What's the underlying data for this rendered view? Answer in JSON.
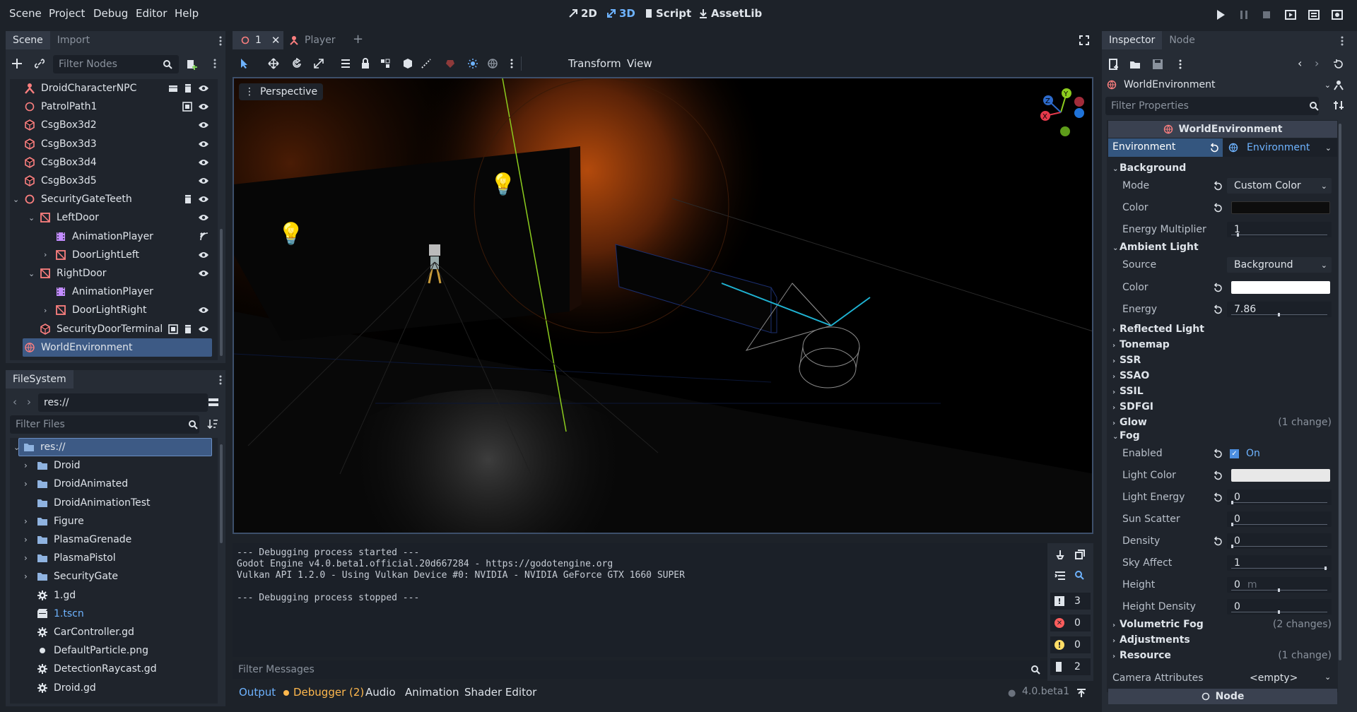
{
  "menu": [
    "Scene",
    "Project",
    "Debug",
    "Editor",
    "Help"
  ],
  "modes": {
    "m2d": "2D",
    "m3d": "3D",
    "script": "Script",
    "assetlib": "AssetLib"
  },
  "scene_dock": {
    "tabs": [
      "Scene",
      "Import"
    ],
    "filter_placeholder": "Filter Nodes",
    "nodes": [
      {
        "label": "DroidCharacterNPC",
        "indent": 0,
        "icon": "character-icon"
      },
      {
        "label": "PatrolPath1",
        "indent": 0,
        "icon": "path-icon"
      },
      {
        "label": "CsgBox3d2",
        "indent": 0,
        "icon": "csg-icon"
      },
      {
        "label": "CsgBox3d3",
        "indent": 0,
        "icon": "csg-icon"
      },
      {
        "label": "CsgBox3d4",
        "indent": 0,
        "icon": "csg-icon"
      },
      {
        "label": "CsgBox3d5",
        "indent": 0,
        "icon": "csg-icon"
      },
      {
        "label": "SecurityGateTeeth",
        "indent": 0,
        "icon": "node3d-icon"
      },
      {
        "label": "LeftDoor",
        "indent": 1,
        "icon": "body-icon"
      },
      {
        "label": "AnimationPlayer",
        "indent": 2,
        "icon": "animation-icon"
      },
      {
        "label": "DoorLightLeft",
        "indent": 2,
        "icon": "body-icon"
      },
      {
        "label": "RightDoor",
        "indent": 1,
        "icon": "body-icon"
      },
      {
        "label": "AnimationPlayer",
        "indent": 2,
        "icon": "animation-icon"
      },
      {
        "label": "DoorLightRight",
        "indent": 2,
        "icon": "body-icon"
      },
      {
        "label": "SecurityDoorTerminal",
        "indent": 1,
        "icon": "csg-icon"
      },
      {
        "label": "WorldEnvironment",
        "indent": 0,
        "icon": "world-icon"
      }
    ]
  },
  "filesystem": {
    "title": "FileSystem",
    "path": "res://",
    "filter_placeholder": "Filter Files",
    "items": [
      {
        "label": "res://",
        "type": "root"
      },
      {
        "label": "Droid",
        "type": "folder"
      },
      {
        "label": "DroidAnimated",
        "type": "folder"
      },
      {
        "label": "DroidAnimationTest",
        "type": "folder"
      },
      {
        "label": "Figure",
        "type": "folder"
      },
      {
        "label": "PlasmaGrenade",
        "type": "folder"
      },
      {
        "label": "PlasmaPistol",
        "type": "folder"
      },
      {
        "label": "SecurityGate",
        "type": "folder"
      },
      {
        "label": "1.gd",
        "type": "script"
      },
      {
        "label": "1.tscn",
        "type": "scene"
      },
      {
        "label": "CarController.gd",
        "type": "script"
      },
      {
        "label": "DefaultParticle.png",
        "type": "image"
      },
      {
        "label": "DetectionRaycast.gd",
        "type": "script"
      },
      {
        "label": "Droid.gd",
        "type": "script"
      }
    ]
  },
  "editor_tabs": [
    {
      "label": "1"
    },
    {
      "label": "Player"
    }
  ],
  "viewport_toolbar": {
    "transform": "Transform",
    "view": "View"
  },
  "viewport": {
    "perspective": "Perspective",
    "gizmo": {
      "x": "X",
      "y": "Y",
      "z": "Z"
    }
  },
  "output": {
    "lines": "--- Debugging process started ---\nGodot Engine v4.0.beta1.official.20d667284 - https://godotengine.org\nVulkan API 1.2.0 - Using Vulkan Device #0: NVIDIA - NVIDIA GeForce GTX 1660 SUPER\n\n--- Debugging process stopped ---",
    "filter_placeholder": "Filter Messages",
    "counts": {
      "messages": "3",
      "errors": "0",
      "warnings": "0",
      "editor": "2"
    }
  },
  "bottom_tabs": {
    "output": "Output",
    "debugger": "Debugger (2)",
    "audio": "Audio",
    "animation": "Animation",
    "shader": "Shader Editor",
    "version": "4.0.beta1"
  },
  "inspector": {
    "tabs": [
      "Inspector",
      "Node"
    ],
    "object": "WorldEnvironment",
    "filter_placeholder": "Filter Properties",
    "header": "WorldEnvironment",
    "environment_label": "Environment",
    "environment_value": "Environment",
    "background": {
      "title": "Background",
      "mode_label": "Mode",
      "mode_value": "Custom Color",
      "color_label": "Color",
      "energy_label": "Energy Multiplier",
      "energy_value": "1"
    },
    "ambient": {
      "title": "Ambient Light",
      "source_label": "Source",
      "source_value": "Background",
      "color_label": "Color",
      "energy_label": "Energy",
      "energy_value": "7.86"
    },
    "collapsed": [
      {
        "label": "Reflected Light",
        "change": ""
      },
      {
        "label": "Tonemap",
        "change": ""
      },
      {
        "label": "SSR",
        "change": ""
      },
      {
        "label": "SSAO",
        "change": ""
      },
      {
        "label": "SSIL",
        "change": ""
      },
      {
        "label": "SDFGI",
        "change": ""
      },
      {
        "label": "Glow",
        "change": "(1 change)"
      }
    ],
    "fog": {
      "title": "Fog",
      "enabled_label": "Enabled",
      "enabled_value": "On",
      "light_color_label": "Light Color",
      "light_energy_label": "Light Energy",
      "light_energy_value": "0",
      "sun_scatter_label": "Sun Scatter",
      "sun_scatter_value": "0",
      "density_label": "Density",
      "density_value": "0",
      "sky_affect_label": "Sky Affect",
      "sky_affect_value": "1",
      "height_label": "Height",
      "height_value": "0",
      "height_unit": "m",
      "height_density_label": "Height Density",
      "height_density_value": "0"
    },
    "after": [
      {
        "label": "Volumetric Fog",
        "change": "(2 changes)"
      },
      {
        "label": "Adjustments",
        "change": ""
      },
      {
        "label": "Resource",
        "change": "(1 change)"
      }
    ],
    "camera_label": "Camera Attributes",
    "camera_value": "<empty>",
    "node_header": "Node"
  },
  "colors": {
    "accent": "#6eb3ff",
    "selection": "#3d5a85",
    "bg": "#1d2229",
    "panel": "#262c35",
    "fog_light": "#e8e8e8",
    "ambient": "#ffffff",
    "bg_color": "#0d0d0d"
  }
}
